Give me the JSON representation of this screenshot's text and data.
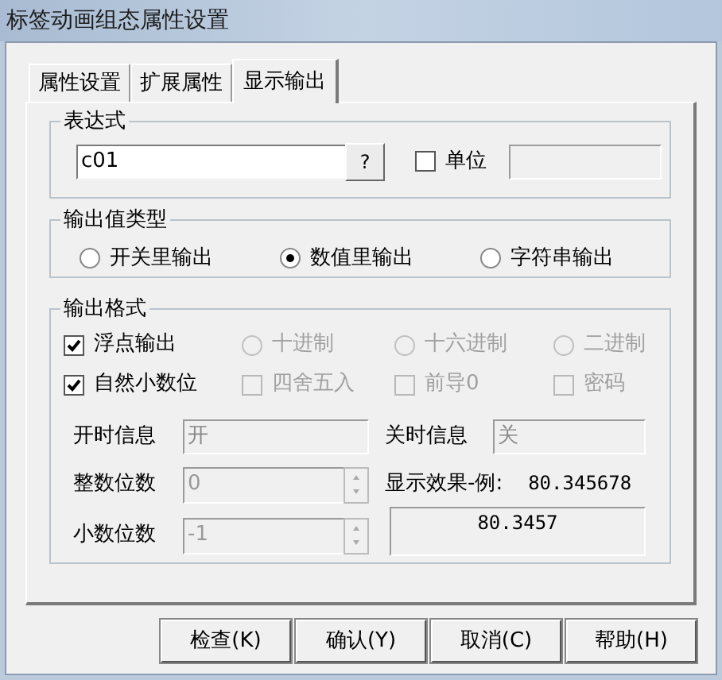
{
  "window": {
    "title": "标签动画组态属性设置"
  },
  "tabs": [
    {
      "label": "属性设置",
      "selected": false
    },
    {
      "label": "扩展属性",
      "selected": false
    },
    {
      "label": "显示输出",
      "selected": true
    }
  ],
  "expression": {
    "title": "表达式",
    "value": "c01",
    "help_button": "?",
    "unit": {
      "label": "单位",
      "checked": false
    }
  },
  "output_type": {
    "title": "输出值类型",
    "options": [
      {
        "label": "开关里输出",
        "selected": false
      },
      {
        "label": "数值里输出",
        "selected": true
      },
      {
        "label": "字符串输出",
        "selected": false
      }
    ]
  },
  "output_format": {
    "title": "输出格式",
    "rows": [
      [
        {
          "kind": "checkbox",
          "label": "浮点输出",
          "checked": true,
          "disabled": false
        },
        {
          "kind": "radio",
          "label": "十进制",
          "selected": false,
          "disabled": true
        },
        {
          "kind": "radio",
          "label": "十六进制",
          "selected": false,
          "disabled": true
        },
        {
          "kind": "radio",
          "label": "二进制",
          "selected": false,
          "disabled": true
        }
      ],
      [
        {
          "kind": "checkbox",
          "label": "自然小数位",
          "checked": true,
          "disabled": false
        },
        {
          "kind": "checkbox",
          "label": "四舍五入",
          "checked": false,
          "disabled": true
        },
        {
          "kind": "checkbox",
          "label": "前导0",
          "checked": false,
          "disabled": true
        },
        {
          "kind": "checkbox",
          "label": "密码",
          "checked": false,
          "disabled": true
        }
      ]
    ],
    "on_info": {
      "label": "开时信息",
      "value": "开",
      "disabled": true
    },
    "off_info": {
      "label": "关时信息",
      "value": "关",
      "disabled": true
    },
    "integer_digits": {
      "label": "整数位数",
      "value": "0",
      "disabled": true
    },
    "decimal_digits": {
      "label": "小数位数",
      "value": "-1",
      "disabled": true
    },
    "preview": {
      "label": "显示效果-例:",
      "sample": "80.345678",
      "result": "80.3457"
    }
  },
  "buttons": [
    "检查(K)",
    "确认(Y)",
    "取消(C)",
    "帮助(H)"
  ]
}
